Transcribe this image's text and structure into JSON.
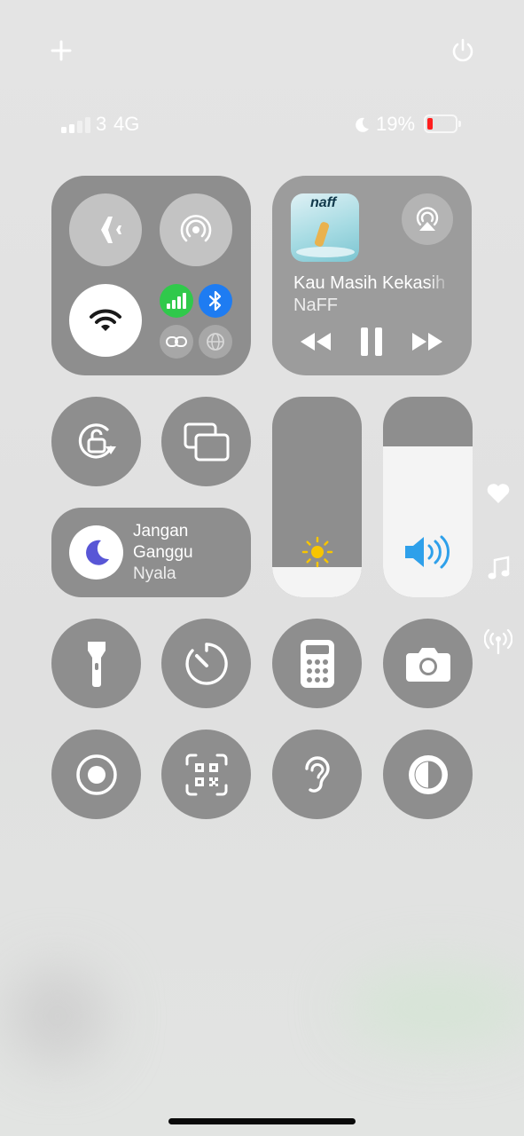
{
  "status_bar": {
    "carrier": "3",
    "network": "4G",
    "battery_percent": "19%",
    "battery_level": 0.19,
    "signal_bars_active": 2,
    "signal_bars_total": 4
  },
  "top_controls": {
    "add_icon": "plus-icon",
    "power_icon": "power-icon"
  },
  "connectivity": {
    "airplane_mode": "airplane-icon",
    "airdrop": "airdrop-icon",
    "wifi": "wifi-icon",
    "cellular": "cellular-icon",
    "bluetooth": "bluetooth-icon",
    "personal_hotspot": "link-icon",
    "vpn": "globe-icon",
    "colors": {
      "cellular": "#30c94b",
      "bluetooth": "#1e7cf2"
    }
  },
  "now_playing": {
    "title": "Kau Masih Kekasih",
    "artist": "NaFF",
    "album_art_text": "naff",
    "airplay_icon": "airplay-icon",
    "rewind_icon": "rewind-icon",
    "pause_icon": "pause-icon",
    "forward_icon": "forward-icon"
  },
  "focus": {
    "line1": "Jangan",
    "line2": "Ganggu",
    "line3": "Nyala",
    "icon": "moon-icon",
    "accent": "#5856d6"
  },
  "sliders": {
    "brightness_level": 0.15,
    "volume_level": 0.75,
    "brightness_icon": "sun-icon",
    "volume_icon": "speaker-icon",
    "colors": {
      "sun": "#f7c500",
      "speaker": "#2ea0ea"
    }
  },
  "side_indicators": [
    "heart-icon",
    "music-note-icon",
    "antenna-icon"
  ],
  "controls": [
    "orientation-lock-icon",
    "screen-mirroring-icon",
    "flashlight-icon",
    "timer-icon",
    "calculator-icon",
    "camera-icon",
    "screen-record-icon",
    "qr-scanner-icon",
    "hearing-icon",
    "dark-mode-icon"
  ]
}
